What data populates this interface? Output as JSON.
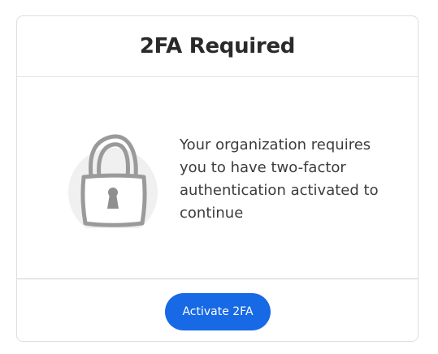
{
  "dialog": {
    "title": "2FA Required",
    "message": "Your organization requires you to have two-factor authentication activated to continue",
    "illustration_icon": "padlock-icon",
    "primary_button_label": "Activate 2FA"
  },
  "colors": {
    "primary": "#1769e5",
    "title_text": "#2a2a2a",
    "body_text": "#3c3c3c",
    "lock_stroke": "#9a9a9a",
    "lock_background": "#f0f0f0",
    "border": "#dedede"
  }
}
